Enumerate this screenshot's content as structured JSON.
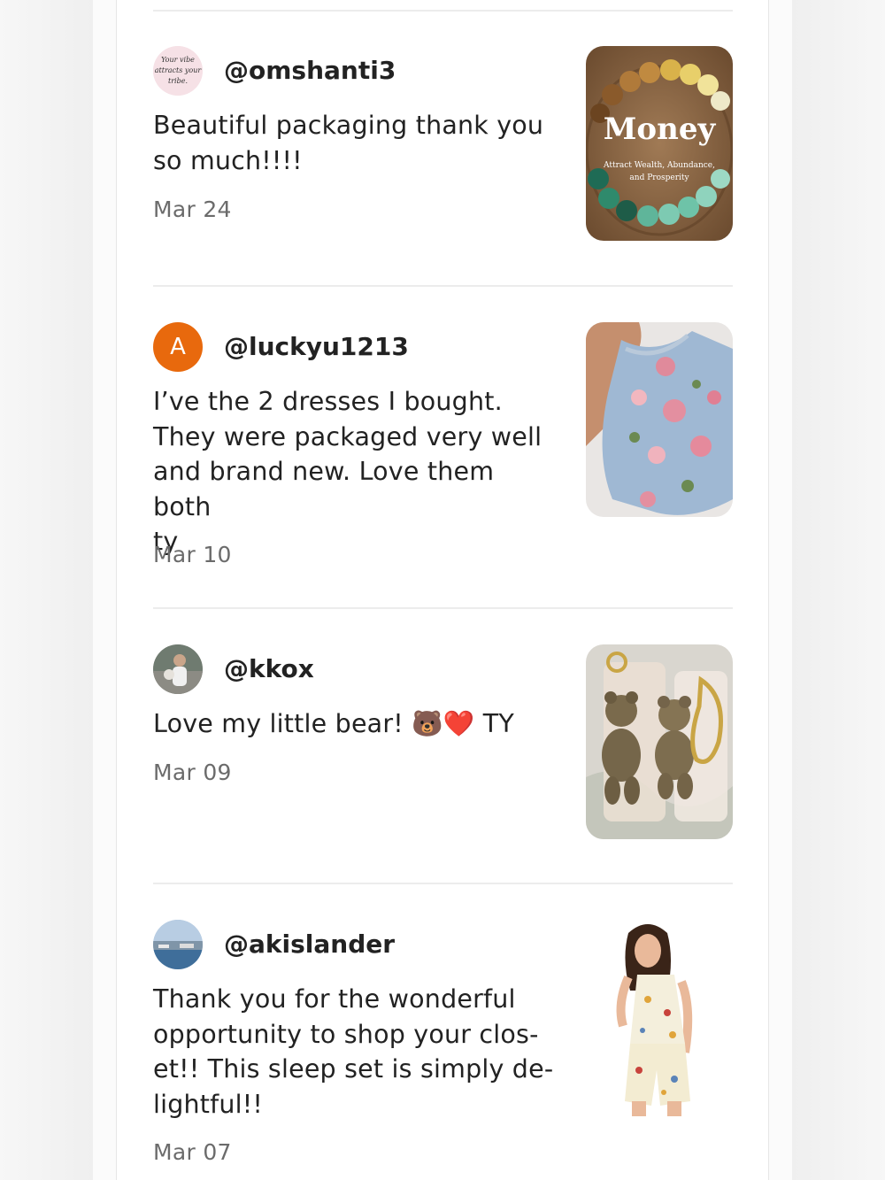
{
  "reviews": [
    {
      "handle": "@omshanti3",
      "avatar_text": "Your vibe attracts your tribe.",
      "text": "Beautiful packaging thank you\nso much!!!!",
      "date": "Mar 24",
      "image": {
        "title": "Money",
        "subtitle": "Attract Wealth, Abundance, and Prosperity"
      }
    },
    {
      "handle": "@luckyu1213",
      "avatar_letter": "A",
      "avatar_color": "#e8690d",
      "text": "I’ve the 2 dresses I bought.\nThey were packaged very well\nand brand new. Love them both\nty",
      "date": "Mar 10"
    },
    {
      "handle": "@kkox",
      "text": "Love my little bear! 🐻❤️ TY",
      "date": "Mar 09"
    },
    {
      "handle": "@akislander",
      "text": "Thank you for the wonderful\nopportunity to shop your clos-\net!! This sleep set is simply de-\nlightful!!",
      "date": "Mar 07"
    }
  ]
}
